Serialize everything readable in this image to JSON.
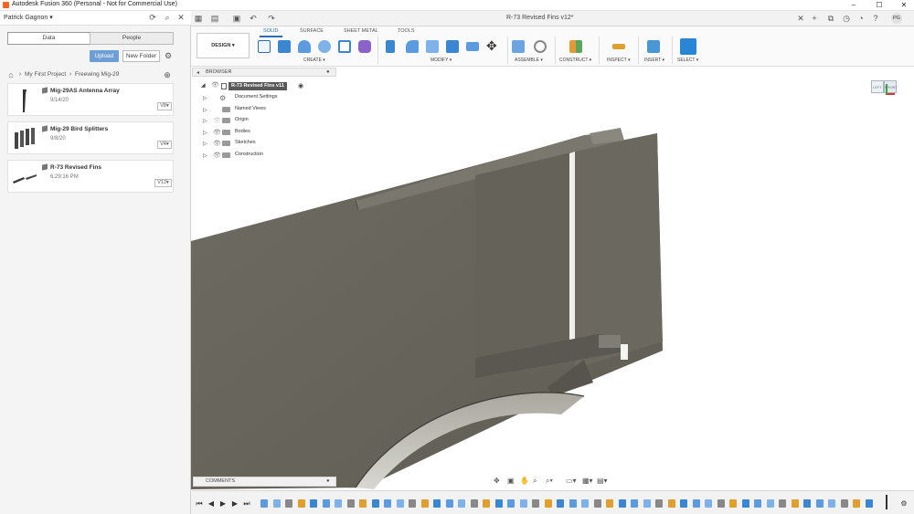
{
  "window": {
    "title": "Autodesk Fusion 360 (Personal - Not for Commercial Use)",
    "controls": [
      "–",
      "☐",
      "✕"
    ]
  },
  "data_panel": {
    "user": "Patrick Gagnon",
    "tabs": [
      "Data",
      "People"
    ],
    "upload_label": "Upload",
    "new_folder_label": "New Folder",
    "breadcrumb": [
      "My First Project",
      "Freewing Mig-29"
    ],
    "files": [
      {
        "name": "Mig-29AS Antenna Array",
        "date": "9/14/20",
        "version": "V8"
      },
      {
        "name": "Mig-29 Bird Splitters",
        "date": "9/8/20",
        "version": "V4"
      },
      {
        "name": "R-73 Revised Fins",
        "date": "6:29:16 PM",
        "version": "V12"
      }
    ]
  },
  "document": {
    "tab_title": "R-73 Revised Fins v12*"
  },
  "ribbon": {
    "workspace": "DESIGN",
    "tabs": [
      "SOLID",
      "SURFACE",
      "SHEET METAL",
      "TOOLS"
    ],
    "active_tab": "SOLID",
    "groups": [
      "CREATE",
      "MODIFY",
      "ASSEMBLE",
      "CONSTRUCT",
      "INSPECT",
      "INSERT",
      "SELECT"
    ],
    "accent": "#2a6fb5"
  },
  "browser": {
    "header": "BROWSER",
    "root": "R-73 Revised Fins v11",
    "items": [
      "Document Settings",
      "Named Views",
      "Origin",
      "Bodies",
      "Sketches",
      "Construction"
    ]
  },
  "comments": {
    "label": "COMMENTS"
  },
  "viewcube": {
    "faces": [
      "LEFT",
      "FRONT"
    ]
  }
}
